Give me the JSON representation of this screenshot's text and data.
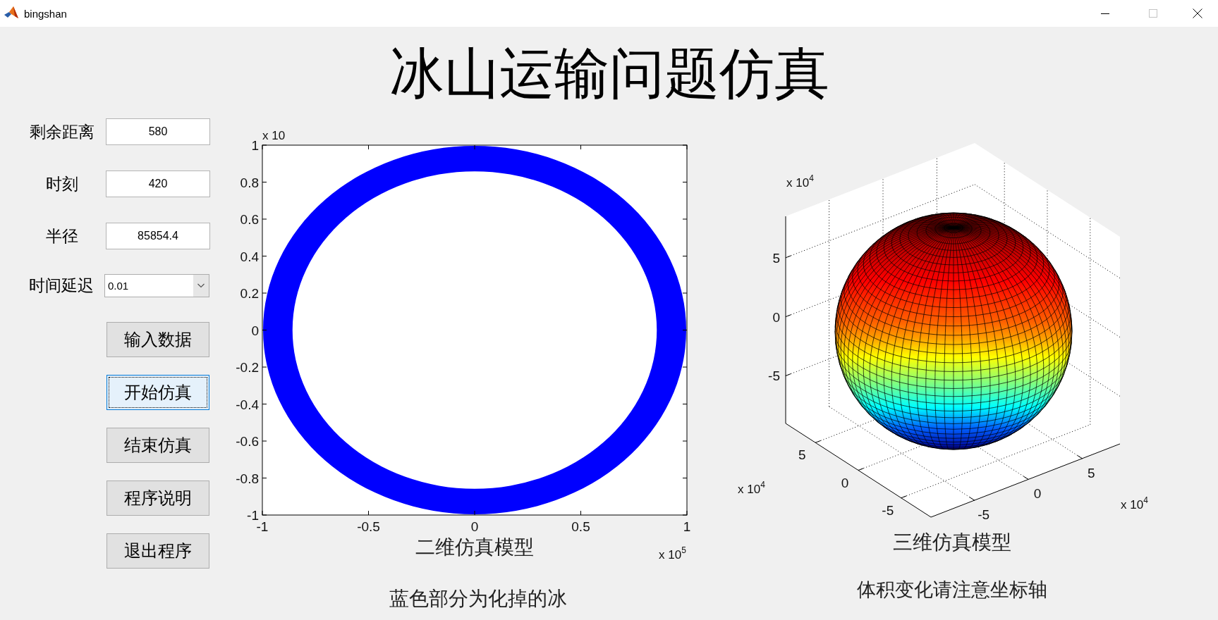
{
  "window": {
    "title": "bingshan",
    "maximize_disabled": true
  },
  "heading": "冰山运输问题仿真",
  "controls": {
    "fields": [
      {
        "label": "剩余距离",
        "value": "580"
      },
      {
        "label": "时刻",
        "value": "420"
      },
      {
        "label": "半径",
        "value": "85854.4"
      }
    ],
    "delay": {
      "label": "时间延迟",
      "value": "0.01"
    },
    "buttons": [
      {
        "label": "输入数据",
        "focused": false
      },
      {
        "label": "开始仿真",
        "focused": true
      },
      {
        "label": "结束仿真",
        "focused": false
      },
      {
        "label": "程序说明",
        "focused": false
      },
      {
        "label": "退出程序",
        "focused": false
      }
    ]
  },
  "plot_2d": {
    "y_exponent_label": {
      "base": "x 10"
    },
    "y_ticks": [
      "1",
      "0.8",
      "0.6",
      "0.4",
      "0.2",
      "0",
      "-0.2",
      "-0.4",
      "-0.6",
      "-0.8",
      "-1"
    ],
    "x_ticks": [
      "-1",
      "-0.5",
      "0",
      "0.5",
      "1"
    ],
    "x_label": "二维仿真模型",
    "x_exponent_label": {
      "base": "x 10",
      "power": "5"
    },
    "note": "蓝色部分为化掉的冰"
  },
  "plot_3d": {
    "exponent_labels": [
      {
        "base": "x 10",
        "power": "4"
      },
      {
        "base": "x 10",
        "power": "4"
      },
      {
        "base": "x 10",
        "power": "4"
      }
    ],
    "vertical_axis_ticks": [
      "5",
      "0",
      "-5"
    ],
    "left_axis_ticks": [
      "5",
      "0",
      "-5"
    ],
    "right_axis_ticks": [
      "-5",
      "0",
      "5"
    ],
    "caption": "三维仿真模型",
    "note": "体积变化请注意坐标轴"
  }
}
